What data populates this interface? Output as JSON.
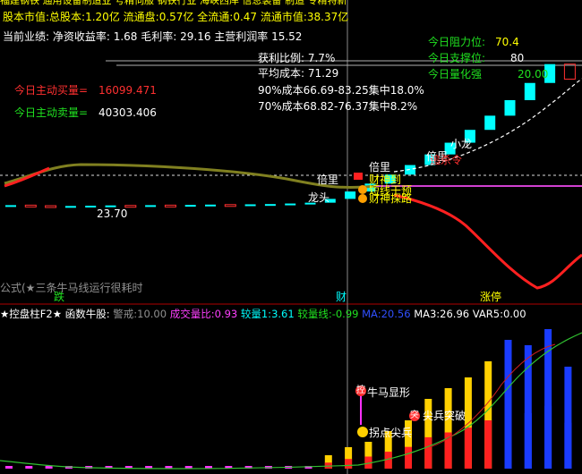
{
  "header": {
    "line1": "福建钢铁 通用设备制造业 号精伺服 钢铁行业 海峡西岸 信息装备 制造 专精特新",
    "line2_label": "股本市值:",
    "line2_total_label": "总股本:",
    "line2_total": "1.20亿",
    "line2_float_label": "流通盘:",
    "line2_float": "0.57亿",
    "line2_full_label": "全流通:",
    "line2_full": "0.47",
    "line2_mv_label": "流通市值:",
    "line2_mv": "38.37亿",
    "line3": "当前业绩: 净资收益率: 1.68 毛利率: 29.16 主营利润率 15.52"
  },
  "stats": {
    "profit_ratio": "获利比例: 7.7%",
    "avg_cost": "平均成本: 71.29",
    "cost90": "90%成本66.69-83.25集中18.0%",
    "cost70": "70%成本68.82-76.37集中8.2%",
    "buy_label": "今日主动买量=",
    "buy_value": "16099.471",
    "sell_label": "今日主动卖量=",
    "sell_value": "40303.406",
    "resistance": "今日阻力位:",
    "resistance_value": "70.4",
    "support": "今日支撑位:",
    "support_value": "80",
    "volume_change": "今日量化强",
    "volume_change_value": "20.00"
  },
  "annotations": {
    "low_price": "23.70",
    "dragon_head": "龙头",
    "small_dragon": "小龙",
    "double_1": "倍里",
    "double_2": "倍里",
    "double_3": "倍里",
    "double_4": "倍里",
    "wealth_god": "财神到",
    "wealth_route": "财神探路",
    "wealth_note": "短线干预",
    "chase": "追杀令",
    "strong": "强",
    "formula_note": "公式(★三条牛马线运行很耗时",
    "label_fall": "跌",
    "label_mid": "财",
    "label_limit": "涨停"
  },
  "indicator": {
    "name": "★控盘柱F2★",
    "fn": "函数牛股:",
    "warn_label": "警戒:",
    "warn": "10.00",
    "vr_label": "成交量比:",
    "vr": "0.93",
    "v1_label": "较量1:",
    "v1": "3.61",
    "vline_label": "较量线:",
    "vline": "-0.99",
    "max_label": "MA:",
    "max": "20.56",
    "ma3_label": "MA3:",
    "ma3": "26.96",
    "var5_label": "VAR5:",
    "var5": "0.00",
    "tag_bull": "牛马显形",
    "tag_point": "拐点尖兵",
    "tag_break": "尖兵突破",
    "icon_bull": "控",
    "icon_break": "突"
  },
  "chart_data": [
    {
      "type": "candlestick",
      "title": "",
      "categories": [],
      "series": [
        {
          "name": "price",
          "values": [
            24.2,
            24.0,
            23.7,
            23.9,
            24.0,
            24.1,
            24.0,
            24.2,
            24.1,
            24.3,
            24.4,
            24.2,
            24.5,
            24.6,
            24.8,
            25.1,
            26.5,
            29.2,
            32.1,
            35.4,
            38.9,
            42.8,
            47.1,
            51.8,
            57.0,
            62.7,
            69.0,
            75.9,
            70.4
          ]
        }
      ]
    },
    {
      "type": "bar",
      "title": "",
      "categories": [],
      "series": [
        {
          "name": "volume",
          "values": [
            1,
            1,
            1,
            1,
            1,
            1,
            1,
            1,
            1,
            1,
            1,
            1,
            1,
            1,
            1,
            1,
            5,
            8,
            10,
            14,
            18,
            26,
            30,
            34,
            40,
            48,
            46,
            52,
            38
          ]
        }
      ]
    }
  ]
}
